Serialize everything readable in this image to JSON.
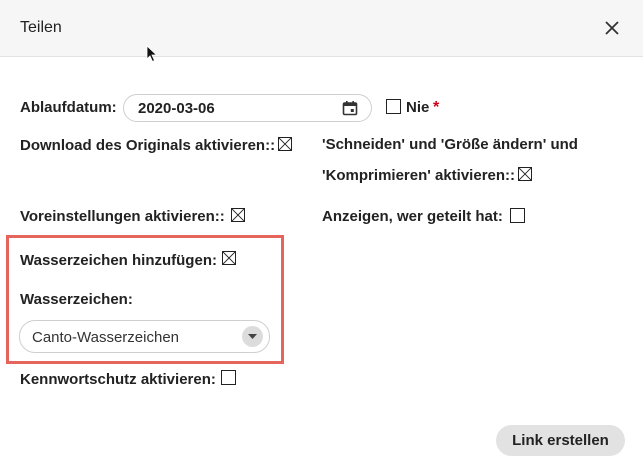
{
  "dialog": {
    "title": "Teilen"
  },
  "form": {
    "expiry_label": "Ablaufdatum:",
    "expiry_value": "2020-03-06",
    "never_label": "Nie",
    "never_checked": false,
    "required_mark": "*",
    "download_original_label": "Download des Originals aktivieren::",
    "download_original_checked": true,
    "crop_resize_label_line1": "'Schneiden' und 'Größe ändern' und",
    "crop_resize_label_line2": "'Komprimieren' aktivieren::",
    "crop_resize_checked": true,
    "presets_label": "Voreinstellungen aktivieren::",
    "presets_checked": true,
    "show_sharer_label": "Anzeigen, wer geteilt hat:",
    "show_sharer_checked": false,
    "add_watermark_label": "Wasserzeichen hinzufügen:",
    "add_watermark_checked": true,
    "watermark_label": "Wasserzeichen:",
    "watermark_selected": "Canto-Wasserzeichen",
    "password_label": "Kennwortschutz aktivieren:",
    "password_checked": false
  },
  "actions": {
    "create_link_label": "Link erstellen"
  },
  "colors": {
    "highlight": "#e5645c",
    "required": "#d0021b",
    "header_bg": "#f6f6f6",
    "button_bg": "#e2e2e2"
  },
  "icons": {
    "close": "close-icon",
    "calendar": "calendar-icon",
    "dropdown": "chevron-down-icon",
    "checked": "checkbox-x-icon"
  }
}
